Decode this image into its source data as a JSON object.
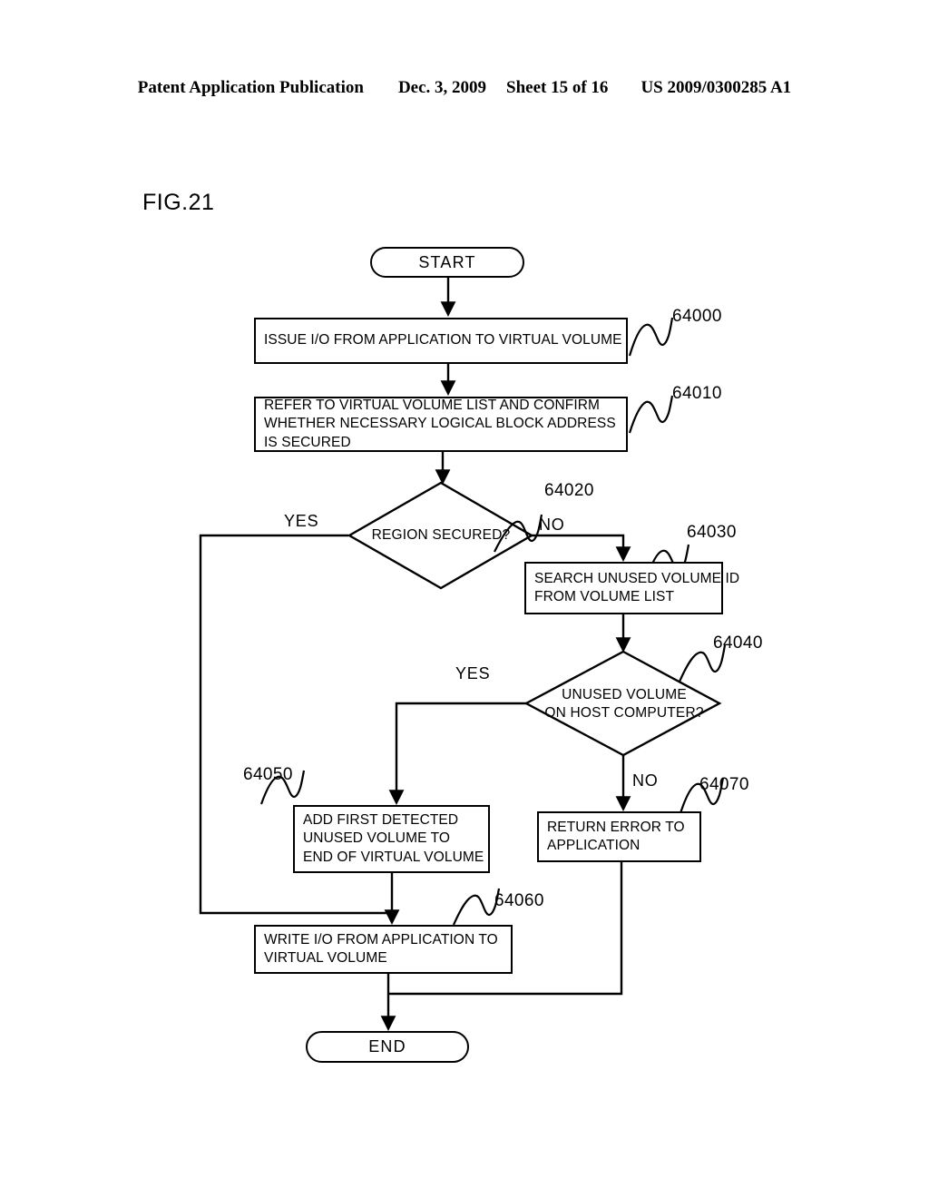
{
  "header": {
    "publication": "Patent Application Publication",
    "date": "Dec. 3, 2009",
    "sheet": "Sheet 15 of 16",
    "docnum": "US 2009/0300285 A1"
  },
  "figure": {
    "label": "FIG.21"
  },
  "flowchart": {
    "start": {
      "label": "START"
    },
    "end": {
      "label": "END"
    },
    "steps": [
      {
        "ref": "64000",
        "lines": [
          "ISSUE I/O FROM APPLICATION TO VIRTUAL VOLUME"
        ]
      },
      {
        "ref": "64010",
        "lines": [
          "REFER TO VIRTUAL VOLUME LIST AND CONFIRM",
          "WHETHER NECESSARY LOGICAL BLOCK ADDRESS",
          "IS SECURED"
        ]
      },
      {
        "ref": "64020",
        "lines": [
          "REGION SECURED?"
        ]
      },
      {
        "ref": "64030",
        "lines": [
          "SEARCH UNUSED VOLUME ID",
          "FROM VOLUME LIST"
        ]
      },
      {
        "ref": "64040",
        "lines": [
          "UNUSED VOLUME",
          "ON HOST COMPUTER?"
        ]
      },
      {
        "ref": "64050",
        "lines": [
          "ADD FIRST DETECTED",
          "UNUSED VOLUME TO",
          "END OF VIRTUAL VOLUME"
        ]
      },
      {
        "ref": "64060",
        "lines": [
          "WRITE I/O FROM APPLICATION TO",
          "VIRTUAL VOLUME"
        ]
      },
      {
        "ref": "64070",
        "lines": [
          "RETURN ERROR TO",
          "APPLICATION"
        ]
      }
    ],
    "branch_labels": {
      "region_secured_yes": "YES",
      "region_secured_no": "NO",
      "unused_volume_yes": "YES",
      "unused_volume_no": "NO"
    }
  },
  "colors": {
    "ink": "#000000",
    "paper": "#ffffff"
  }
}
